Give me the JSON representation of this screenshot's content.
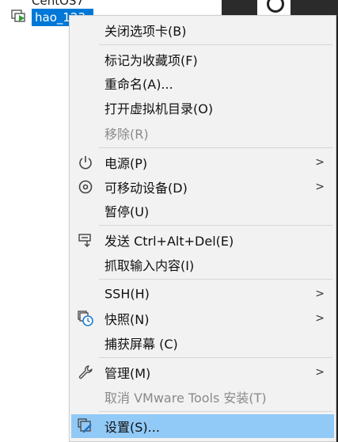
{
  "tree": {
    "top_item_label": "CentOS7",
    "vm_label": "hao_123"
  },
  "menu": {
    "items": [
      {
        "label": "关闭选项卡(B)"
      },
      {
        "label": "标记为收藏项(F)"
      },
      {
        "label": "重命名(A)..."
      },
      {
        "label": "打开虚拟机目录(O)"
      },
      {
        "label": "移除(R)"
      },
      {
        "label": "电源(P)",
        "arrow": ">"
      },
      {
        "label": "可移动设备(D)",
        "arrow": ">"
      },
      {
        "label": "暂停(U)"
      },
      {
        "label": "发送 Ctrl+Alt+Del(E)"
      },
      {
        "label": "抓取输入内容(I)"
      },
      {
        "label": "SSH(H)",
        "arrow": ">"
      },
      {
        "label": "快照(N)",
        "arrow": ">"
      },
      {
        "label": "捕获屏幕 (C)"
      },
      {
        "label": "管理(M)",
        "arrow": ">"
      },
      {
        "label": "取消 VMware Tools 安装(T)"
      },
      {
        "label": "设置(S)..."
      }
    ]
  },
  "colors": {
    "selection": "#91c9f7",
    "tree_selection": "#0078d7",
    "disabled_text": "#8a8a8a"
  }
}
